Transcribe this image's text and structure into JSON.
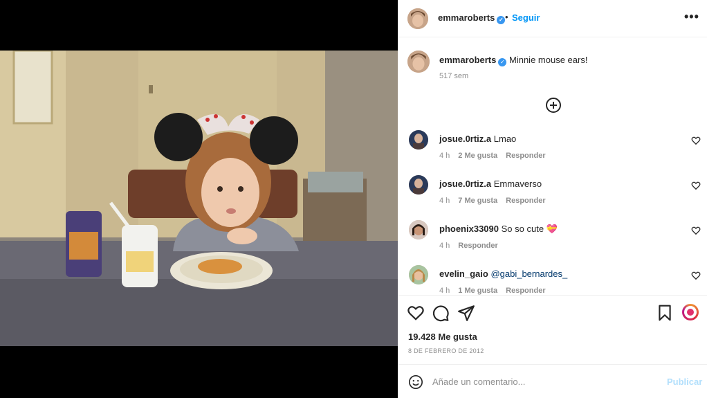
{
  "post": {
    "username": "emmaroberts",
    "separator": "•",
    "follow_label": "Seguir",
    "more_icon": "more-horizontal-icon",
    "caption": "Minnie mouse ears!",
    "caption_time": "517 sem"
  },
  "comments": [
    {
      "user": "josue.0rtiz.a",
      "text": "Lmao",
      "time": "4 h",
      "likes": "2 Me gusta",
      "reply": "Responder"
    },
    {
      "user": "josue.0rtiz.a",
      "text": "Emmaverso",
      "time": "4 h",
      "likes": "7 Me gusta",
      "reply": "Responder"
    },
    {
      "user": "phoenix33090",
      "text": "So so cute 💝",
      "time": "4 h",
      "likes": "",
      "reply": "Responder"
    },
    {
      "user": "evelin_gaio",
      "text": "@gabi_bernardes_",
      "time": "4 h",
      "likes": "1 Me gusta",
      "reply": "Responder"
    }
  ],
  "actions": {
    "likes_count": "19.428 Me gusta",
    "date": "8 DE FEBRERO DE 2012"
  },
  "composer": {
    "placeholder": "Añade un comentario...",
    "publish_label": "Publicar"
  },
  "colors": {
    "accent": "#0095f6",
    "verified": "#3897f0",
    "muted": "#8e8e8e",
    "publish_disabled": "#b2dffc"
  }
}
